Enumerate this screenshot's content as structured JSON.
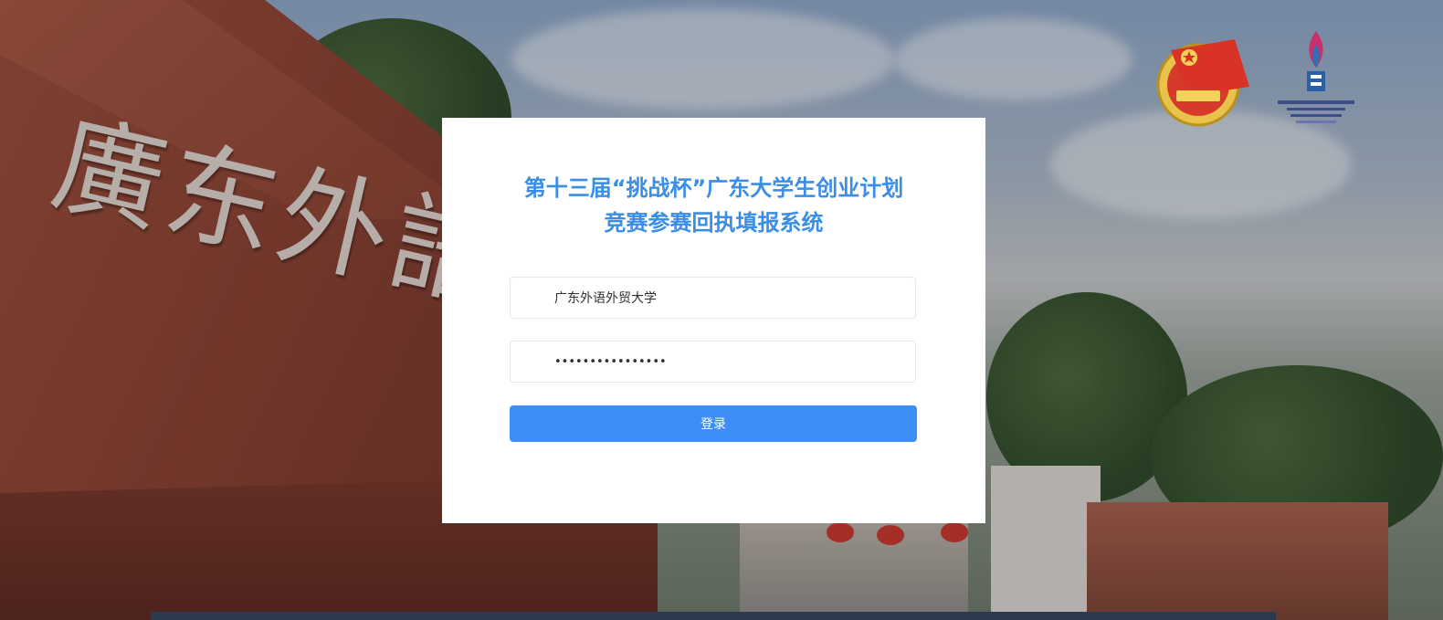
{
  "login": {
    "title_line1": "第十三届“挑战杯”广东大学生创业计划",
    "title_line2": "竞赛参赛回执填报系统",
    "username_value": "广东外语外贸大学",
    "password_value": "••••••••••••••••",
    "login_button_label": "登录"
  },
  "background": {
    "gate_calligraphy": "廣东外語"
  },
  "colors": {
    "accent": "#3e8ef7",
    "title": "#3a8ee6"
  }
}
